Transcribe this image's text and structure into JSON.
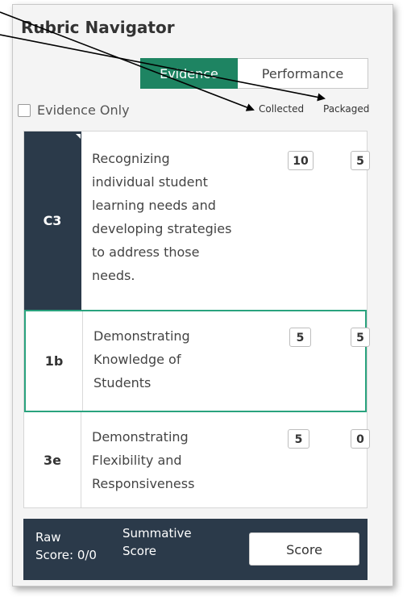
{
  "panel": {
    "title": "Rubric Navigator"
  },
  "toggle": {
    "evidence_label": "Evidence",
    "performance_label": "Performance"
  },
  "filter": {
    "evidence_only_label": "Evidence Only",
    "evidence_only_checked": false
  },
  "columns": {
    "collected": "Collected",
    "packaged": "Packaged"
  },
  "rows": [
    {
      "code": "C3",
      "description_lines": [
        "Recognizing",
        "individual student",
        "learning needs and",
        "developing strategies",
        "to address those",
        "needs."
      ],
      "collected": "10",
      "packaged": "5"
    },
    {
      "code": "1b",
      "description_lines": [
        "Demonstrating",
        "Knowledge of",
        "Students"
      ],
      "collected": "5",
      "packaged": "5"
    },
    {
      "code": "3e",
      "description_lines": [
        "Demonstrating",
        "Flexibility and",
        "Responsiveness"
      ],
      "collected": "5",
      "packaged": "0"
    }
  ],
  "footer": {
    "raw_line1": "Raw",
    "raw_line2": "Score: 0/0",
    "summative_line1": "Summative",
    "summative_line2": "Score",
    "score_button": "Score"
  },
  "colors": {
    "accent": "#1e8462",
    "dark": "#2b3a4a",
    "selected_border": "#2aa37e"
  }
}
